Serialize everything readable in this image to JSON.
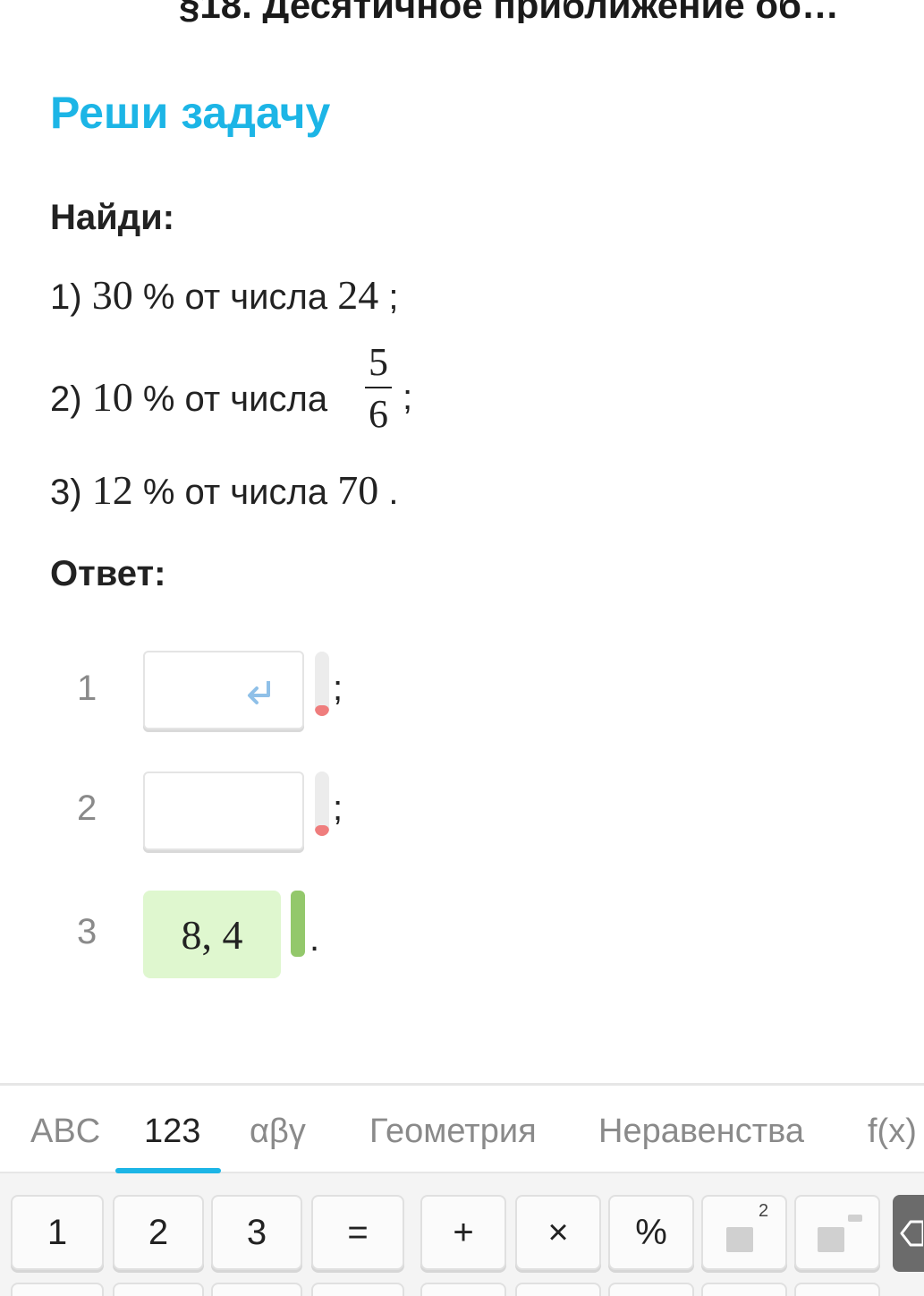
{
  "header": {
    "title": "§18. Десятичное приближение об…"
  },
  "task": {
    "heading": "Реши задачу",
    "find_label": "Найди:",
    "problems": [
      {
        "prefix": "1)",
        "percent": "30",
        "mid": "% от числа",
        "number": "24",
        "end": ";"
      },
      {
        "prefix": "2)",
        "percent": "10",
        "mid": "% от числа",
        "frac_num": "5",
        "frac_den": "6",
        "end": ";"
      },
      {
        "prefix": "3)",
        "percent": "12",
        "mid": "% от числа",
        "number": "70",
        "end": "."
      }
    ],
    "answer_label": "Ответ:"
  },
  "answers": [
    {
      "index": "1",
      "value": "",
      "separator": ";",
      "status": "empty"
    },
    {
      "index": "2",
      "value": "",
      "separator": ";",
      "status": "empty"
    },
    {
      "index": "3",
      "value": "8, 4",
      "separator": ".",
      "status": "correct"
    }
  ],
  "keyboard": {
    "tabs": [
      "ABC",
      "123",
      "αβγ",
      "Геометрия",
      "Неравенства",
      "f(x)"
    ],
    "active_tab": "123",
    "keys": [
      "1",
      "2",
      "3",
      "=",
      "+",
      "×",
      "%"
    ],
    "power_superscript": "2"
  },
  "colors": {
    "accent": "#1cb5e6",
    "correct_bg": "#dff7cf",
    "correct_indicator": "#93c86b",
    "empty_indicator": "#ef7d7d"
  },
  "icons": {
    "back": "chevron-left-icon",
    "enter": "enter-icon",
    "backspace": "backspace-icon"
  }
}
